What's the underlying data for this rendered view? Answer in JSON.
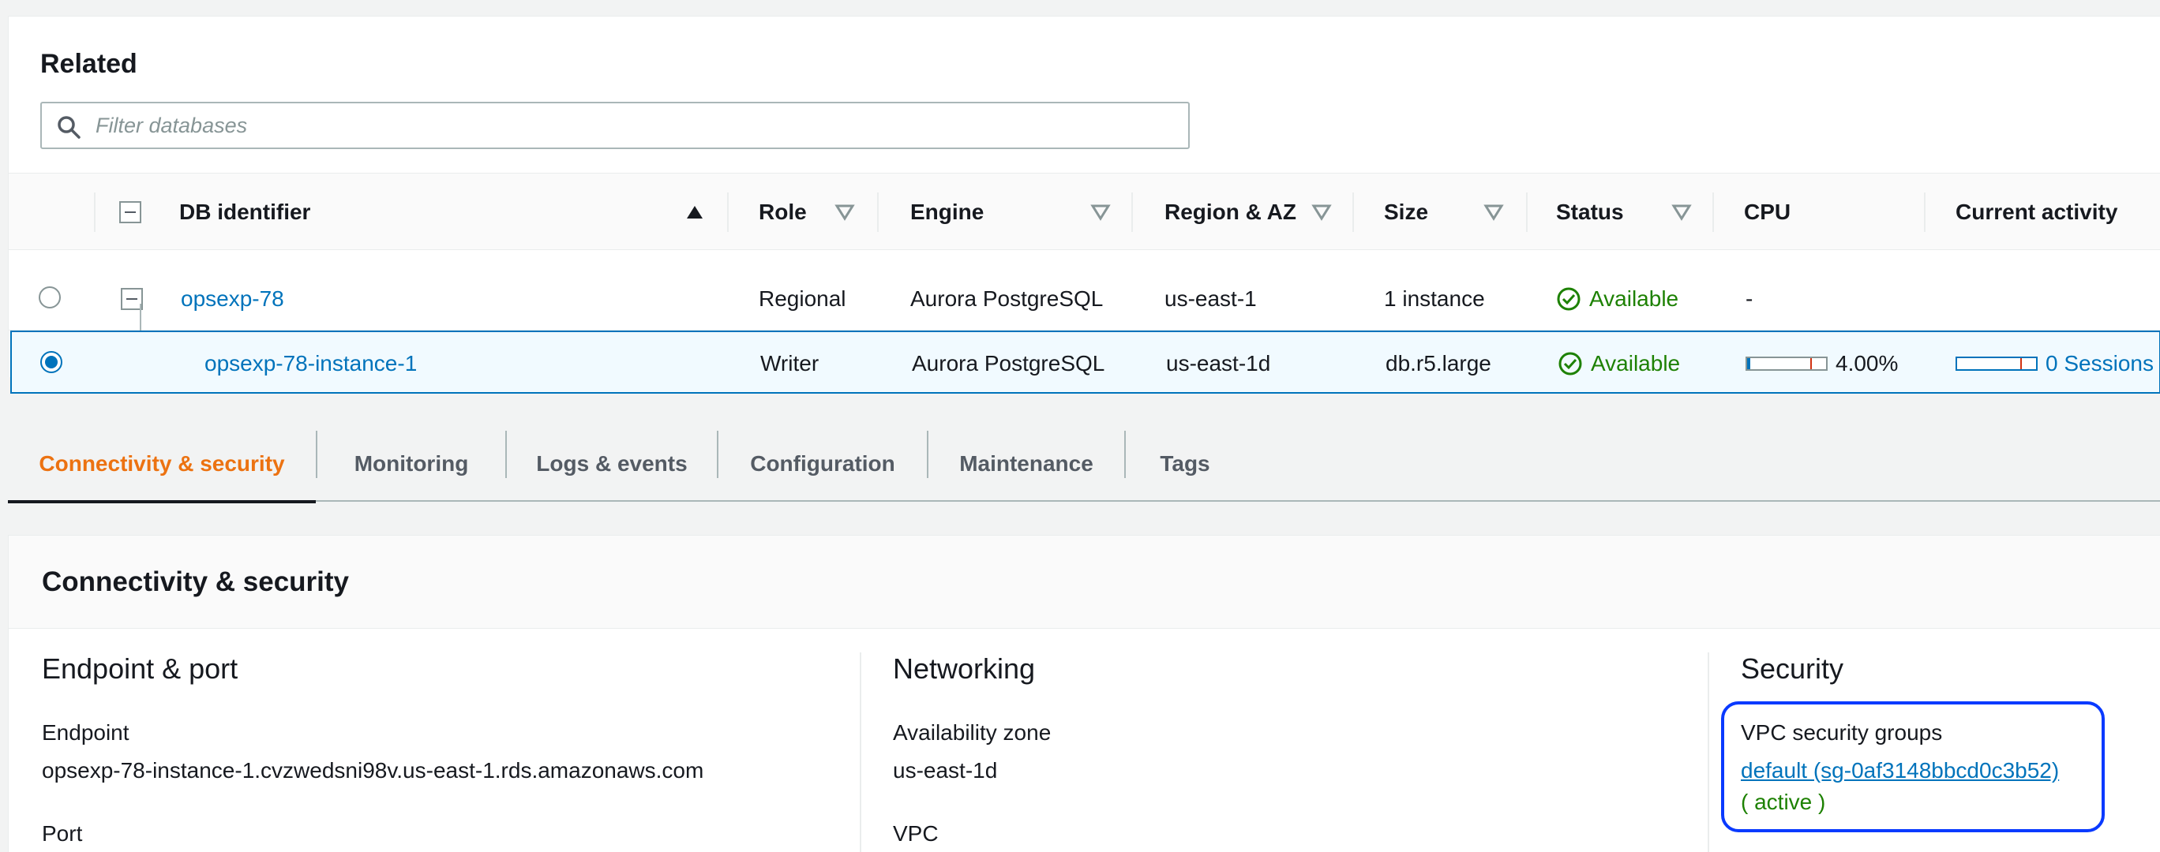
{
  "related": {
    "title": "Related",
    "filter_placeholder": "Filter databases"
  },
  "table": {
    "headers": {
      "db_identifier": "DB identifier",
      "role": "Role",
      "engine": "Engine",
      "region_az": "Region & AZ",
      "size": "Size",
      "status": "Status",
      "cpu": "CPU",
      "current_activity": "Current activity"
    },
    "rows": [
      {
        "db_identifier": "opsexp-78",
        "role": "Regional",
        "engine": "Aurora PostgreSQL",
        "region_az": "us-east-1",
        "size": "1 instance",
        "status": "Available",
        "cpu": "-",
        "current_activity": "",
        "selected": false
      },
      {
        "db_identifier": "opsexp-78-instance-1",
        "role": "Writer",
        "engine": "Aurora PostgreSQL",
        "region_az": "us-east-1d",
        "size": "db.r5.large",
        "status": "Available",
        "cpu": "4.00%",
        "cpu_fraction": 0.04,
        "current_activity": "0 Sessions",
        "sessions_fraction": 0.0,
        "selected": true
      }
    ]
  },
  "tabs": [
    {
      "label": "Connectivity & security",
      "active": true
    },
    {
      "label": "Monitoring",
      "active": false
    },
    {
      "label": "Logs & events",
      "active": false
    },
    {
      "label": "Configuration",
      "active": false
    },
    {
      "label": "Maintenance",
      "active": false
    },
    {
      "label": "Tags",
      "active": false
    }
  ],
  "panel": {
    "title": "Connectivity & security",
    "endpoint_port": {
      "heading": "Endpoint & port",
      "endpoint_label": "Endpoint",
      "endpoint_value": "opsexp-78-instance-1.cvzwedsni98v.us-east-1.rds.amazonaws.com",
      "port_label": "Port"
    },
    "networking": {
      "heading": "Networking",
      "az_label": "Availability zone",
      "az_value": "us-east-1d",
      "vpc_label": "VPC"
    },
    "security": {
      "heading": "Security",
      "sg_label": "VPC security groups",
      "sg_link": "default (sg-0af3148bbcd0c3b52)",
      "sg_status": "( active )"
    }
  },
  "colors": {
    "link": "#0073bb",
    "success": "#1d8102",
    "active_tab": "#ec7211",
    "highlight_box": "#0a3aff",
    "selected_row_bg": "#f1faff"
  }
}
